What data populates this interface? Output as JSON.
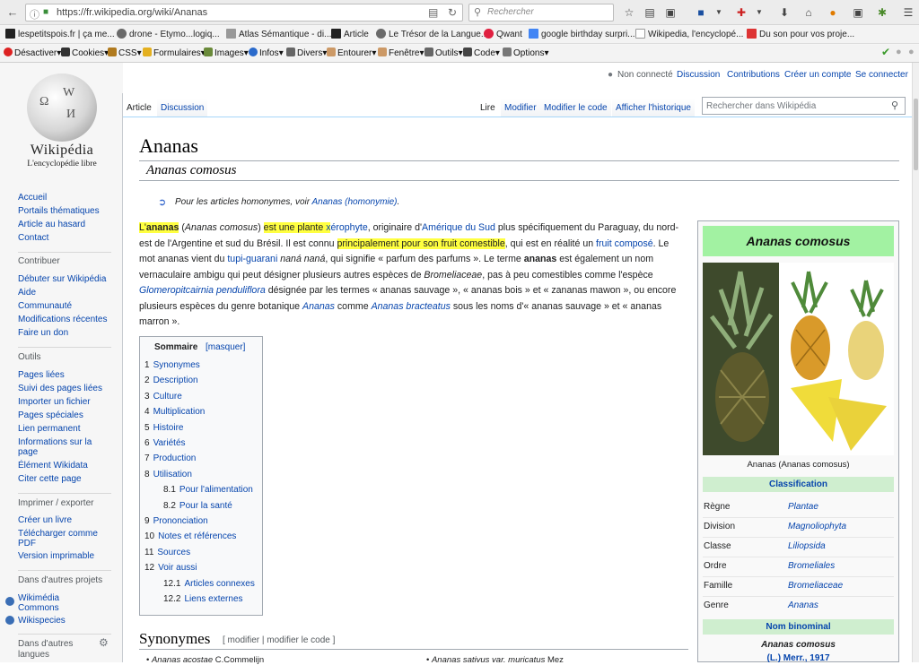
{
  "browser": {
    "url": "https://fr.wikipedia.org/wiki/Ananas",
    "search_placeholder": "Rechercher",
    "bookmarks": [
      "lespetitspois.fr | ça me...",
      "drone - Etymo...logiq...",
      "Atlas Sémantique - di...",
      "Article",
      "Le Trésor de la Langue...",
      "Qwant",
      "google birthday surpri...",
      "Wikipedia, l'encyclopé...",
      "Du son pour vos proje..."
    ],
    "webdev": [
      "Désactiver",
      "Cookies",
      "CSS",
      "Formulaires",
      "Images",
      "Infos",
      "Divers",
      "Entourer",
      "Fenêtre",
      "Outils",
      "Code",
      "Options"
    ]
  },
  "wiki": {
    "logo_title": "Wikipédia",
    "logo_subtitle": "L'encyclopédie libre",
    "user": [
      "Non connecté",
      "Discussion",
      "Contributions",
      "Créer un compte",
      "Se connecter"
    ],
    "tabs_left": [
      "Article",
      "Discussion"
    ],
    "tabs_right": [
      "Lire",
      "Modifier",
      "Modifier le code",
      "Afficher l'historique"
    ],
    "search_placeholder": "Rechercher dans Wikipédia",
    "sidebar": {
      "main": [
        "Accueil",
        "Portails thématiques",
        "Article au hasard",
        "Contact"
      ],
      "contribuer_h": "Contribuer",
      "contribuer": [
        "Débuter sur Wikipédia",
        "Aide",
        "Communauté",
        "Modifications récentes",
        "Faire un don"
      ],
      "outils_h": "Outils",
      "outils": [
        "Pages liées",
        "Suivi des pages liées",
        "Importer un fichier",
        "Pages spéciales",
        "Lien permanent",
        "Informations sur la",
        "page",
        "Élément Wikidata",
        "Citer cette page"
      ],
      "imprimer_h": "Imprimer / exporter",
      "imprimer": [
        "Créer un livre",
        "Télécharger comme",
        "PDF",
        "Version imprimable"
      ],
      "projets_h": "Dans d'autres projets",
      "projets": [
        "Wikimédia",
        "Commons",
        "Wikispecies"
      ],
      "langues_h": "Dans d'autres",
      "langues_h2": "langues"
    },
    "title": "Ananas",
    "subtitle": "Ananas comosus",
    "homonym_pre": "Pour les articles homonymes, voir ",
    "homonym_link": "Ananas (homonymie)",
    "homonym_post": ".",
    "toc_title": "Sommaire",
    "toc_toggle": "[masquer]",
    "toc": [
      {
        "n": "1",
        "t": "Synonymes",
        "lvl": 1
      },
      {
        "n": "2",
        "t": "Description",
        "lvl": 1
      },
      {
        "n": "3",
        "t": "Culture",
        "lvl": 1
      },
      {
        "n": "4",
        "t": "Multiplication",
        "lvl": 1
      },
      {
        "n": "5",
        "t": "Histoire",
        "lvl": 1
      },
      {
        "n": "6",
        "t": "Variétés",
        "lvl": 1
      },
      {
        "n": "7",
        "t": "Production",
        "lvl": 1
      },
      {
        "n": "8",
        "t": "Utilisation",
        "lvl": 1
      },
      {
        "n": "8.1",
        "t": "Pour l'alimentation",
        "lvl": 2
      },
      {
        "n": "8.2",
        "t": "Pour la santé",
        "lvl": 2
      },
      {
        "n": "9",
        "t": "Prononciation",
        "lvl": 1
      },
      {
        "n": "10",
        "t": "Notes et références",
        "lvl": 1
      },
      {
        "n": "11",
        "t": "Sources",
        "lvl": 1
      },
      {
        "n": "12",
        "t": "Voir aussi",
        "lvl": 1
      },
      {
        "n": "12.1",
        "t": "Articles connexes",
        "lvl": 2
      },
      {
        "n": "12.2",
        "t": "Liens externes",
        "lvl": 2
      }
    ],
    "section1": "Synonymes",
    "section1_edit": "[ modifier | modifier le code ]",
    "syn_left_it": "Ananas acostae",
    "syn_left": " C.Commelijn",
    "syn_right_it": "Ananas sativus var. muricatus",
    "syn_right": " Mez",
    "infobox": {
      "title": "Ananas comosus",
      "caption": "Ananas (Ananas comosus)",
      "classification": "Classification",
      "rows": [
        {
          "k": "Règne",
          "v": "Plantae"
        },
        {
          "k": "Division",
          "v": "Magnoliophyta"
        },
        {
          "k": "Classe",
          "v": "Liliopsida"
        },
        {
          "k": "Ordre",
          "v": "Bromeliales"
        },
        {
          "k": "Famille",
          "v": "Bromeliaceae"
        },
        {
          "k": "Genre",
          "v": "Ananas"
        }
      ],
      "binomial_h": "Nom binominal",
      "binomial": "Ananas comosus",
      "author": "(L.) Merr., 1917"
    }
  }
}
